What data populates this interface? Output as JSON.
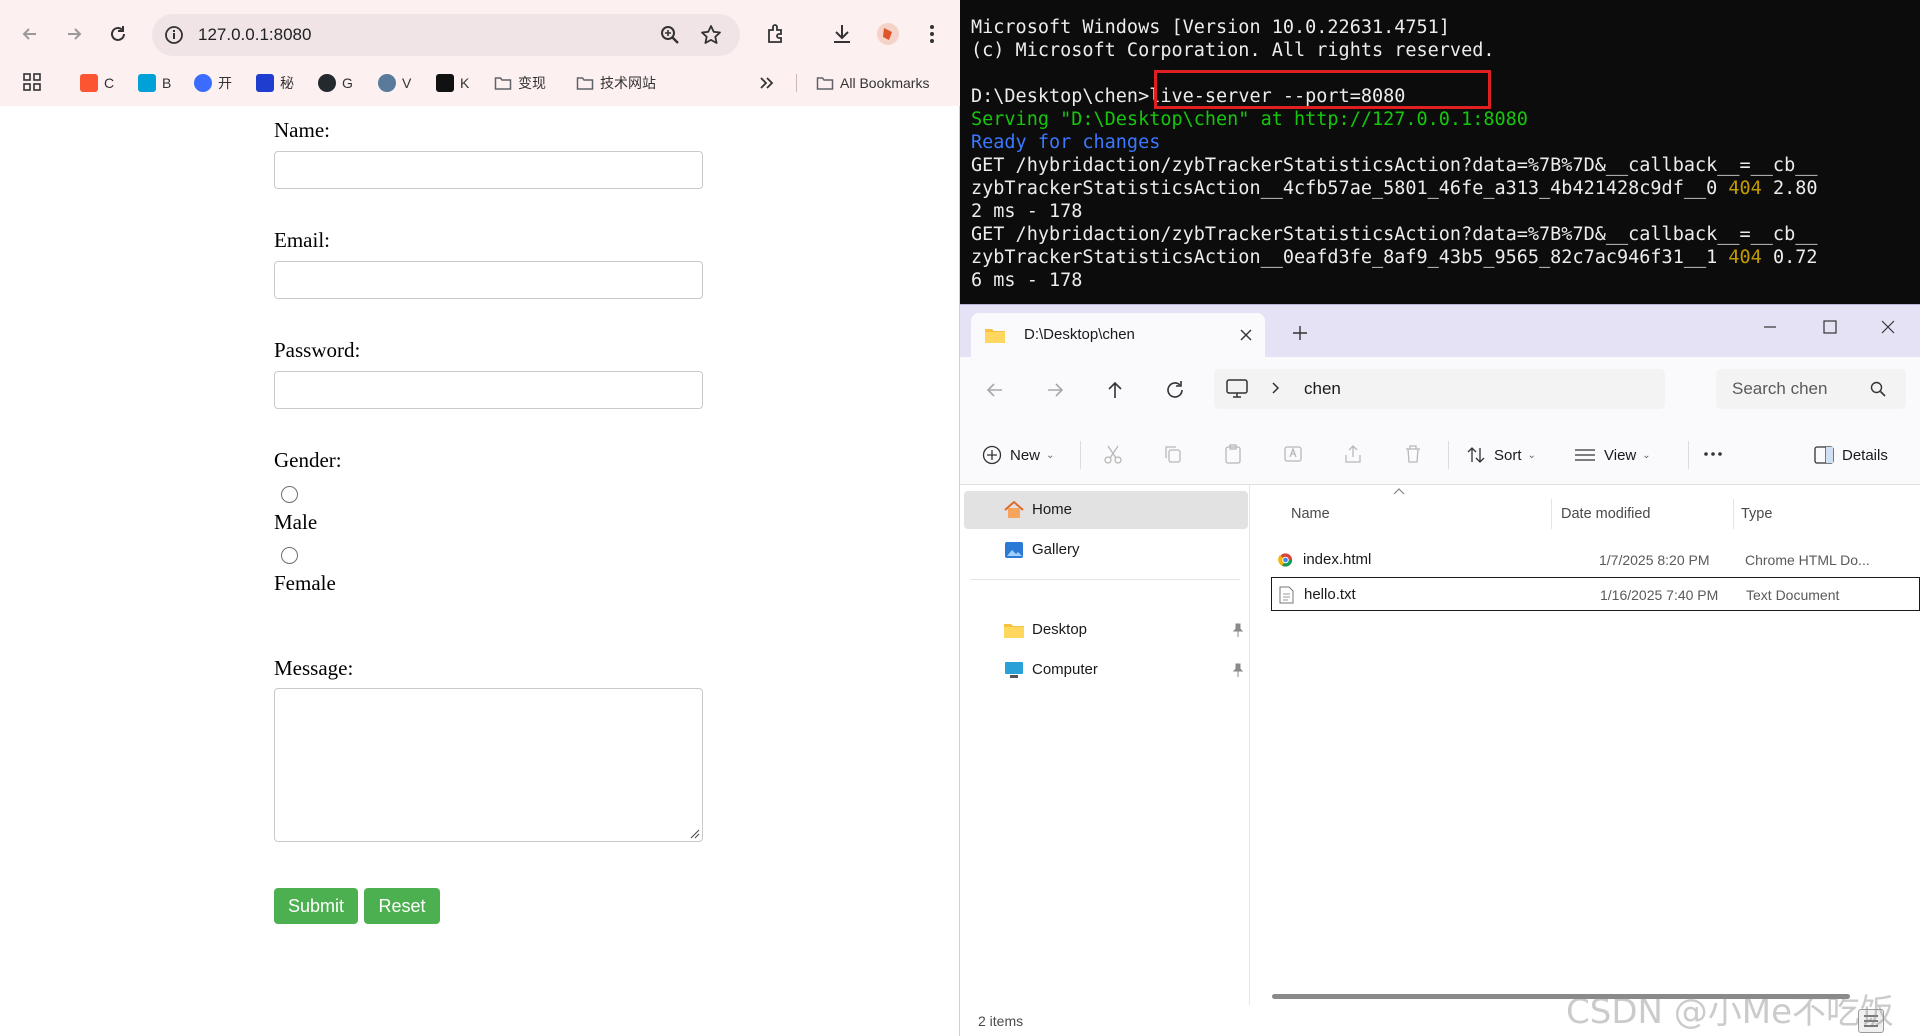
{
  "browser": {
    "url": "127.0.0.1:8080",
    "bookmarks": [
      {
        "label": "C",
        "color": "#fc5531"
      },
      {
        "label": "B",
        "color": "#00a1d6"
      },
      {
        "label": "开",
        "color": "#3b6cff"
      },
      {
        "label": "秘",
        "color": "#1f3ecf"
      },
      {
        "label": "G",
        "color": "#24292e"
      },
      {
        "label": "V",
        "color": "#5a7a9c"
      },
      {
        "label": "K",
        "color": "#111111"
      },
      {
        "label": "变现",
        "color": "#5f6368"
      },
      {
        "label": "技术网站",
        "color": "#5f6368"
      }
    ],
    "all_bookmarks": "All Bookmarks"
  },
  "form": {
    "name_label": "Name:",
    "email_label": "Email:",
    "password_label": "Password:",
    "gender_label": "Gender:",
    "male_label": "Male",
    "female_label": "Female",
    "message_label": "Message:",
    "submit_label": "Submit",
    "reset_label": "Reset",
    "button_color": "#4caf50"
  },
  "terminal": {
    "line1": "Microsoft Windows [Version 10.0.22631.4751]",
    "line2": "(c) Microsoft Corporation. All rights reserved.",
    "prompt": "D:\\Desktop\\chen>",
    "command": "live-server --port=8080",
    "serving": "Serving \"D:\\Desktop\\chen\" at http://127.0.0.1:8080",
    "ready": "Ready for changes",
    "get1_a": "GET /hybridaction/zybTrackerStatisticsAction?data=%7B%7D&__callback__=__cb__",
    "get1_b": "zybTrackerStatisticsAction__4cfb57ae_5801_46fe_a313_4b421428c9df__0 ",
    "get1_code": "404",
    "get1_c": " 2.80",
    "get1_d": "2 ms - 178",
    "get2_a": "GET /hybridaction/zybTrackerStatisticsAction?data=%7B%7D&__callback__=__cb__",
    "get2_b": "zybTrackerStatisticsAction__0eafd3fe_8af9_43b5_9565_82c7ac946f31__1 ",
    "get2_code": "404",
    "get2_c": " 0.72",
    "get2_d": "6 ms - 178"
  },
  "explorer": {
    "tab_title": "D:\\Desktop\\chen",
    "breadcrumb": "chen",
    "search_placeholder": "Search chen",
    "cmd": {
      "new": "New",
      "sort": "Sort",
      "view": "View",
      "details": "Details"
    },
    "nav": {
      "home": "Home",
      "gallery": "Gallery",
      "desktop": "Desktop",
      "computer": "Computer"
    },
    "columns": {
      "name": "Name",
      "date": "Date modified",
      "type": "Type"
    },
    "files": [
      {
        "name": "index.html",
        "date": "1/7/2025 8:20 PM",
        "type": "Chrome HTML Do..."
      },
      {
        "name": "hello.txt",
        "date": "1/16/2025 7:40 PM",
        "type": "Text Document"
      }
    ],
    "status": "2 items"
  },
  "watermark": "CSDN @小Me不吃饭"
}
